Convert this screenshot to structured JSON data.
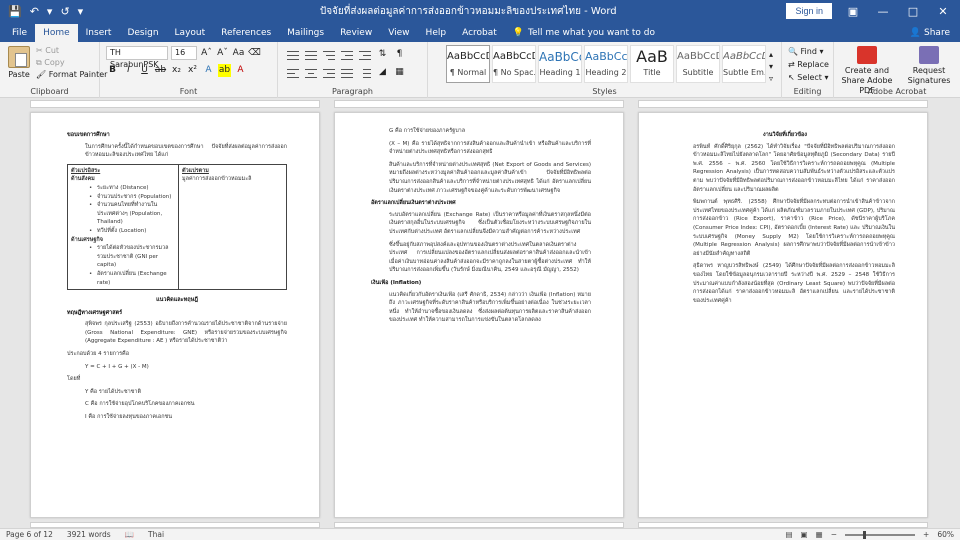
{
  "titlebar": {
    "title": "ปัจจัยที่ส่งผลต่อมูลค่าการส่งออกข้าวหอมมะลิของประเทศไทย - Word",
    "signin": "Sign in"
  },
  "tabs": [
    "File",
    "Home",
    "Insert",
    "Design",
    "Layout",
    "References",
    "Mailings",
    "Review",
    "View",
    "Help",
    "Acrobat"
  ],
  "tellme": "Tell me what you want to do",
  "share": "Share",
  "ribbon": {
    "clipboard": {
      "label": "Clipboard",
      "paste": "Paste",
      "cut": "Cut",
      "copy": "Copy",
      "format_painter": "Format Painter"
    },
    "font": {
      "label": "Font",
      "family": "TH SarabunPSK",
      "size": "16"
    },
    "paragraph": {
      "label": "Paragraph"
    },
    "styles": {
      "label": "Styles",
      "items": [
        {
          "sample": "AaBbCcDd",
          "name": "¶ Normal"
        },
        {
          "sample": "AaBbCcDd",
          "name": "¶ No Spac..."
        },
        {
          "sample": "AaBbCc",
          "name": "Heading 1"
        },
        {
          "sample": "AaBbCc[",
          "name": "Heading 2"
        },
        {
          "sample": "AaB",
          "name": "Title"
        },
        {
          "sample": "AaBbCcD",
          "name": "Subtitle"
        },
        {
          "sample": "AaBbCcDd",
          "name": "Subtle Em..."
        }
      ]
    },
    "editing": {
      "label": "Editing",
      "find": "Find",
      "replace": "Replace",
      "select": "Select"
    },
    "acrobat": {
      "label": "Adobe Acrobat",
      "create_share": "Create and Share Adobe PDF",
      "request_sig": "Request Signatures"
    }
  },
  "pages": {
    "p1": {
      "h_scope": "ขอบเขตการศึกษา",
      "scope_text": "ในการศึกษาครั้งนี้ได้กำหนดขอบเขตของการศึกษา ปัจจัยที่ส่งผลต่อมูลค่าการส่งออกข้าวหอมมะลิของประเทศไทย ได้แก่",
      "tbl_left_head": "ตัวแปรอิสระ",
      "tbl_left_sub1": "ด้านสังคม",
      "tbl_left_items1": [
        "ระยะทาง (Distance)",
        "จำนวนประชากร (Population)",
        "จำนวนคนไทยที่ทำงานในประเทศต่างๆ (Population, Thailand)",
        "ทวีปที่ตั้ง (Location)"
      ],
      "tbl_left_sub2": "ด้านเศรษฐกิจ",
      "tbl_left_items2": [
        "รายได้ต่อหัวของประชากรมวลรวมประชาชาติ (GNI per capita)",
        "อัตราแลกเปลี่ยน (Exchange rate)"
      ],
      "tbl_right_head": "ตัวแปรตาม",
      "tbl_right_text": "มูลค่าการส่งออกข้าวหอมมะลิ",
      "h_theory": "แนวคิดและทฤษฎี",
      "h_macro": "ทฤษฎีทางเศรษฐศาสตร์",
      "macro_text": "สุพิจพร กุลประเสริฐ (2553) อธิบายถึงการคำนวณรายได้ประชาชาติจากด้านรายจ่าย (Gross National Expenditure: GNE) หรือรายจ่ายรวมของระบบเศรษฐกิจ (Aggregate Expenditure : AE ) หรือรายได้ประชาชาติว่า",
      "eq_intro": "ประกอบด้วย 4 รายการคือ",
      "equation": "Y = C + I + G + (X - M)",
      "where": "โดยที่",
      "def_y": "Y คือ รายได้ประชาชาติ",
      "def_c": "C คือ การใช้จ่ายอุปโภคบริโภคของภาคเอกชน",
      "def_i": "I คือ การใช้จ่ายลงทุนของภาคเอกชน"
    },
    "p2": {
      "def_g": "G คือ การใช้จ่ายของภาครัฐบาล",
      "def_xm": "(X – M) คือ รายได้สุทธิจากการส่งสินค้าออกและสินค้านำเข้า หรือสินค้าและบริการที่จำหน่ายต่างประเทศสุทธิหรือการส่งออกสุทธิ",
      "nx_text": "สินค้าและบริการที่จำหน่ายต่างประเทศสุทธิ (Net Export of Goods and Services) หมายถึงผลต่างระหว่างมูลค่าสินค้าออกและมูลค่าสินค้าเข้า ปัจจัยที่มีอิทธิพลต่อปริมาณการส่งออกสินค้าและบริการที่จำหน่ายต่างประเทศสุทธิ ได้แก่ อัตราแลกเปลี่ยนเงินตราต่างประเทศ ภาวะเศรษฐกิจของคู่ค้าและระดับการพัฒนาเศรษฐกิจ",
      "h_fx": "อัตราแลกเปลี่ยนเงินตราต่างประเทศ",
      "fx_text1": "ระบบอัตราแลกเปลี่ยน (Exchange Rate) เป็นราคาหรือมูลค่าที่เงินตราสกุลหนึ่งมีต่อเงินตราสกุลอื่นในระบบเศรษฐกิจ ซึ่งเป็นตัวเชื่อมโยงระหว่างระบบเศรษฐกิจภายในประเทศกับต่างประเทศ อัตราแลกเปลี่ยนจึงมีความสำคัญต่อการค้าระหว่างประเทศ",
      "fx_text2": "ซึ่งขึ้นอยู่กับสภาพอุปสงค์และอุปทานของเงินตราต่างประเทศในตลาดเงินตราต่างประเทศ การเปลี่ยนแปลงของอัตราแลกเปลี่ยนส่งผลต่อราคาสินค้าส่งออกและนำเข้า เมื่อค่าเงินบาทอ่อนค่าลงสินค้าส่งออกจะมีราคาถูกลงในสายตาผู้ซื้อต่างประเทศ ทำให้ปริมาณการส่งออกเพิ่มขึ้น (วันรักษ์ มิ่งมณีนาคิน, 2549 และอรุณี มัญญา, 2552)",
      "h_inf": "เงินเฟ้อ (Inflation)",
      "inf_text": "แนวคิดเกี่ยวกับอัตราเงินเฟ้อ (เสรี ศักดาธิ, 2534) กล่าวว่า เงินเฟ้อ (Inflation) หมายถึง ภาวะเศรษฐกิจที่ระดับราคาสินค้าหรือบริการเพิ่มขึ้นอย่างต่อเนื่อง ในช่วงระยะเวลาหนึ่ง ทำให้อำนาจซื้อของเงินลดลง ซึ่งส่งผลต่อต้นทุนการผลิตและราคาสินค้าส่งออกของประเทศ ทำให้ความสามารถในการแข่งขันในตลาดโลกลดลง"
    },
    "p3": {
      "h_review": "งานวิจัยที่เกี่ยวข้อง",
      "r1": "อรพินท์ ศักดิ์ศิริยุกุล (2562) ได้ทำวิจัยเรื่อง \"ปัจจัยที่มีอิทธิพลต่อปริมาณการส่งออกข้าวหอมมะลิไทยไปยังตลาดโลก\" โดยอาศัยข้อมูลทุติยภูมิ (Secondary Data) รายปี พ.ศ. 2556 – พ.ศ. 2560 โดยใช้วิธีการวิเคราะห์การถดถอยพหุคูณ (Multiple Regression Analysis) เป็นการทดสอบความสัมพันธ์ระหว่างตัวแปรอิสระและตัวแปรตาม พบว่าปัจจัยที่มีอิทธิพลต่อปริมาณการส่งออกข้าวหอมมะลิไทย ได้แก่ ราคาส่งออก อัตราแลกเปลี่ยน และปริมาณผลผลิต",
      "r2": "พิมพกานต์ พุทธศิริ. (2558) ศึกษาปัจจัยที่มีผลกระทบต่อการนำเข้าสินค้าข้าวจากประเทศไทยของประเทศคู่ค้า ได้แก่ ผลิตภัณฑ์มวลรวมภายในประเทศ (GDP), ปริมาณการส่งออกข้าว (Rice Export), ราคาข้าว (Rice Price), ดัชนีราคาผู้บริโภค (Consumer Price Index: CPI), อัตราดอกเบี้ย (Interest Rate) และ ปริมาณเงินในระบบเศรษฐกิจ (Money Supply M2) โดยใช้การวิเคราะห์การถดถอยพหุคูณ (Multiple Regression Analysis) ผลการศึกษาพบว่าปัจจัยที่มีผลต่อการนำเข้าข้าวอย่างมีนัยสำคัญทางสถิติ",
      "r3": "สุธิดาพร หาญบวรสิทธิพงษ์ (2549) ได้ศึกษาปัจจัยที่มีผลต่อการส่งออกข้าวหอมมะลิของไทย โดยใช้ข้อมูลอนุกรมเวลารายปี ระหว่างปี พ.ศ. 2529 – 2548 ใช้วิธีการประมาณค่าแบบกำลังสองน้อยที่สุด (Ordinary Least Square) พบว่าปัจจัยที่มีผลต่อการส่งออกได้แก่ ราคาส่งออกข้าวหอมมะลิ อัตราแลกเปลี่ยน และรายได้ประชาชาติของประเทศคู่ค้า"
    }
  },
  "status": {
    "page": "Page 6 of 12",
    "words": "3921 words",
    "lang": "Thai",
    "zoom": "60%",
    "zoom_fraction": 0.6
  },
  "colors": {
    "brand": "#2b579a",
    "ribbon_bg": "#f3f3f3",
    "canvas": "#e6e6e6"
  }
}
